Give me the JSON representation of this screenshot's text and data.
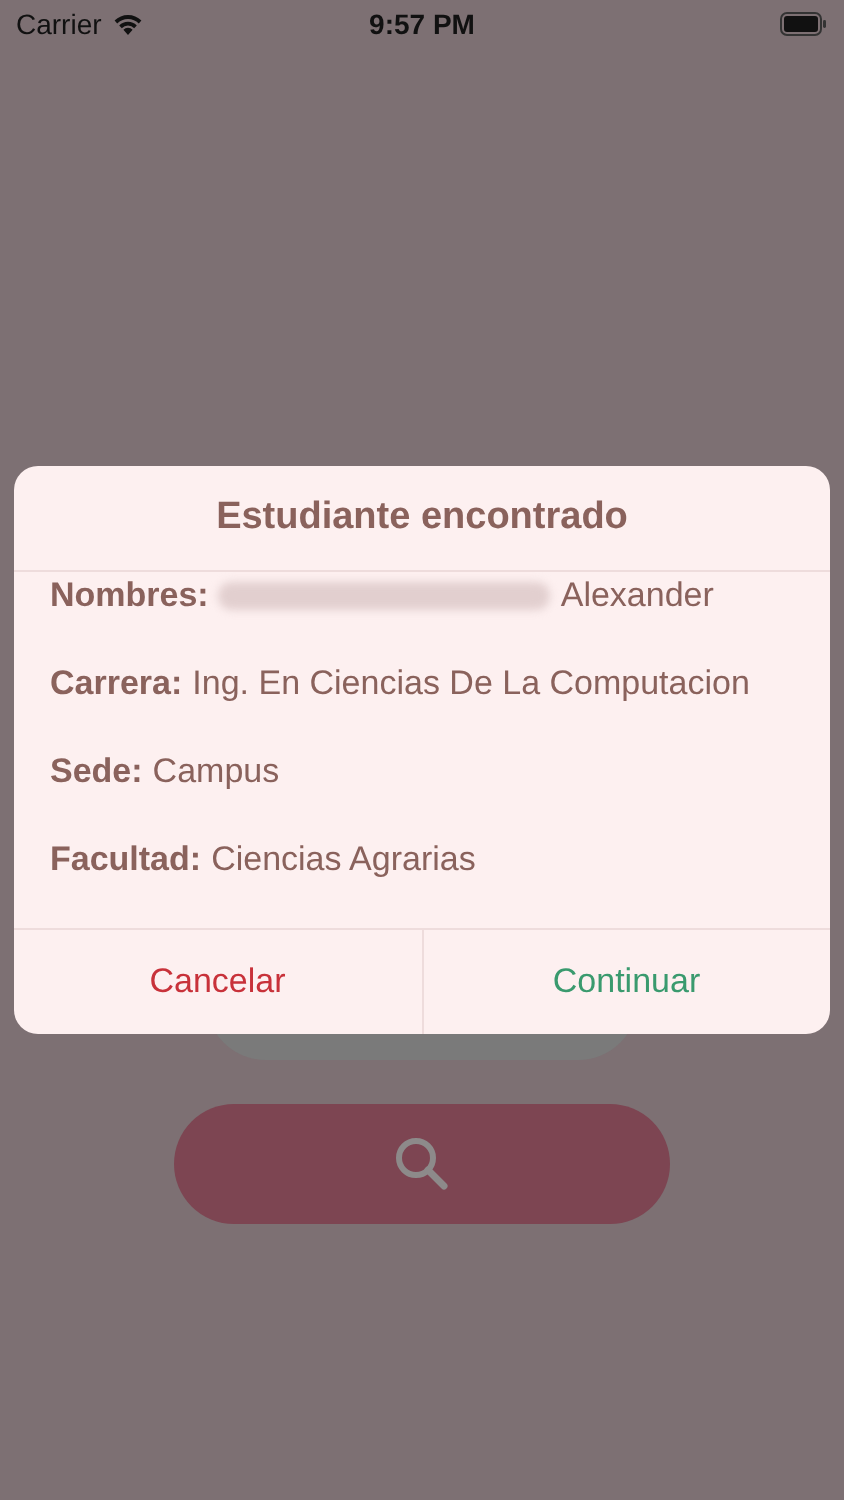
{
  "status_bar": {
    "carrier": "Carrier",
    "time": "9:57 PM"
  },
  "dialog": {
    "title": "Estudiante encontrado",
    "fields": [
      {
        "label": "Nombres:",
        "value": "Alexander",
        "redacted": true
      },
      {
        "label": "Carrera:",
        "value": "Ing. En Ciencias De La Computacion",
        "redacted": false
      },
      {
        "label": "Sede:",
        "value": "Campus",
        "redacted": false
      },
      {
        "label": "Facultad:",
        "value": "Ciencias Agrarias",
        "redacted": false
      }
    ],
    "buttons": [
      {
        "label": "Cancelar",
        "kind": "cancel"
      },
      {
        "label": "Continuar",
        "kind": "confirm"
      }
    ]
  }
}
